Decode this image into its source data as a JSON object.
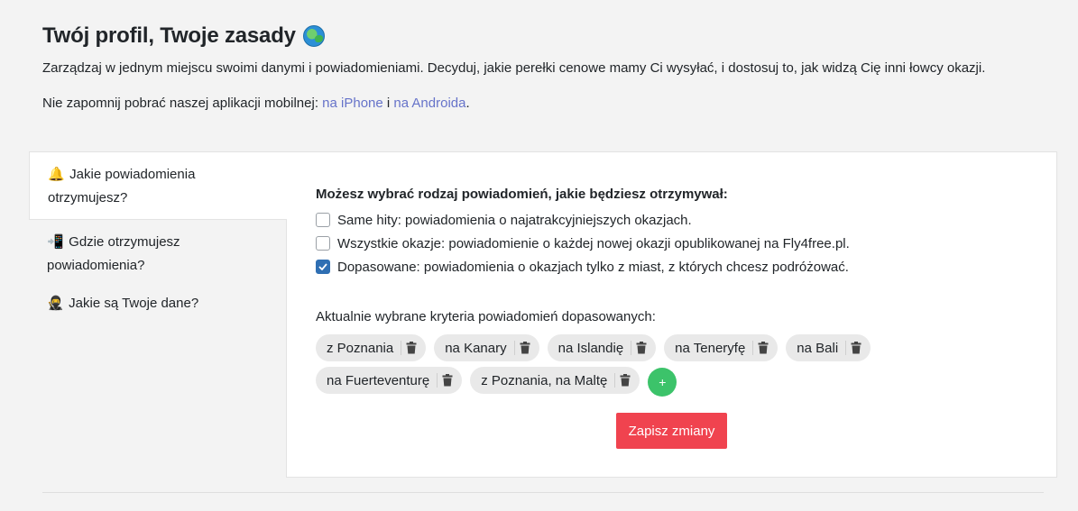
{
  "header": {
    "title": "Twój profil, Twoje zasady",
    "title_icon": "globe-icon",
    "intro": "Zarządzaj w jednym miejscu swoimi danymi i powiadomieniami. Decyduj, jakie perełki cenowe mamy Ci wysyłać, i dostosuj to, jak widzą Cię inni łowcy okazji.",
    "app_prefix": "Nie zapomnij pobrać naszej aplikacji mobilnej: ",
    "iphone_link": "na iPhone",
    "app_and": " i ",
    "android_link": "na Androida",
    "app_suffix": "."
  },
  "sidebar": {
    "items": [
      {
        "icon": "🔔",
        "icon_name": "bell-icon",
        "label": "Jakie powiadomienia otrzymujesz?",
        "active": true
      },
      {
        "icon": "📲",
        "icon_name": "mobile-phone-icon",
        "label": "Gdzie otrzymujesz powiadomienia?",
        "active": false
      },
      {
        "icon": "🥷",
        "icon_name": "ninja-icon",
        "label": "Jakie są Twoje dane?",
        "active": false
      }
    ]
  },
  "panel": {
    "heading": "Możesz wybrać rodzaj powiadomień, jakie będziesz otrzymywał:",
    "options": [
      {
        "label": "Same hity: powiadomienia o najatrakcyjniejszych okazjach.",
        "checked": false
      },
      {
        "label": "Wszystkie okazje: powiadomienie o każdej nowej okazji opublikowanej na Fly4free.pl.",
        "checked": false
      },
      {
        "label": "Dopasowane: powiadomienia o okazjach tylko z miast, z których chcesz podróżować.",
        "checked": true
      }
    ],
    "criteria_label": "Aktualnie wybrane kryteria powiadomień dopasowanych:",
    "tags": [
      "z Poznania",
      "na Kanary",
      "na Islandię",
      "na Teneryfę",
      "na Bali",
      "na Fuerteventurę",
      "z Poznania, na Maltę"
    ],
    "add_label": "+",
    "save_label": "Zapisz zmiany"
  },
  "colors": {
    "accent_link": "#6673c9",
    "save_button": "#f0434f",
    "add_button": "#3cc36a",
    "checkbox_checked": "#2f6fb3"
  }
}
